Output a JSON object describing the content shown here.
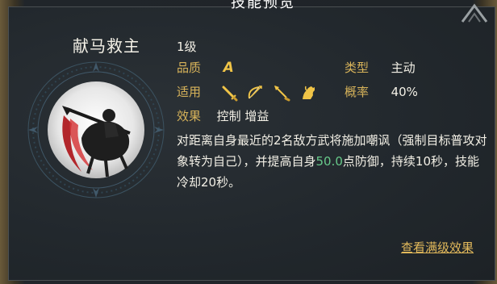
{
  "header": {
    "title": "技能预览"
  },
  "skill": {
    "name": "献马救主",
    "level": "1级",
    "quality_label": "品质",
    "quality_value": "A",
    "type_label": "类型",
    "type_value": "主动",
    "apply_label": "适用",
    "apply_icons": [
      "sword-icon",
      "bow-icon",
      "spear-icon",
      "cavalry-horse-icon"
    ],
    "rate_label": "概率",
    "rate_value": "40%",
    "effect_label": "效果",
    "effect_value": "控制 增益",
    "desc_part1": "对距离自身最近的2名敌方武将施加嘲讽（强制目标普攻对象转为自己），并提高自身",
    "desc_highlight": "50.0",
    "desc_part2": "点防御，持续10秒，技能冷却20秒。"
  },
  "actions": {
    "view_full": "查看满级效果"
  },
  "colors": {
    "label": "#d7b35a",
    "highlight": "#67c98a",
    "link": "#e2b95b",
    "grade": "#f0c447"
  }
}
